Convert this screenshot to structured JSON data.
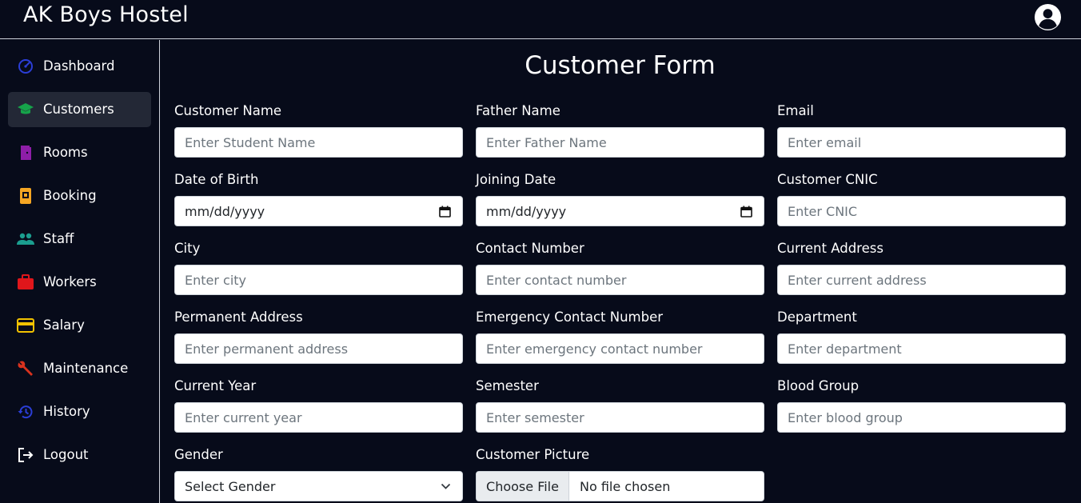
{
  "app": {
    "title": "AK Boys Hostel"
  },
  "sidebar": {
    "items": [
      {
        "label": "Dashboard",
        "icon": "dashboard-gauge-icon",
        "color": "#2b3ed6"
      },
      {
        "label": "Customers",
        "icon": "graduation-cap-icon",
        "color": "#16a34a",
        "active": true
      },
      {
        "label": "Rooms",
        "icon": "door-icon",
        "color": "#8e1ea8"
      },
      {
        "label": "Booking",
        "icon": "booking-icon",
        "color": "#f5a623"
      },
      {
        "label": "Staff",
        "icon": "people-icon",
        "color": "#1b9e8f"
      },
      {
        "label": "Workers",
        "icon": "briefcase-icon",
        "color": "#e0161b"
      },
      {
        "label": "Salary",
        "icon": "credit-card-icon",
        "color": "#f2c200"
      },
      {
        "label": "Maintenance",
        "icon": "wrench-icon",
        "color": "#d9321e"
      },
      {
        "label": "History",
        "icon": "history-icon",
        "color": "#2b3ed6"
      },
      {
        "label": "Logout",
        "icon": "logout-icon",
        "color": "#ffffff"
      }
    ]
  },
  "form": {
    "title": "Customer Form",
    "fields": {
      "customer_name": {
        "label": "Customer Name",
        "placeholder": "Enter Student Name"
      },
      "father_name": {
        "label": "Father Name",
        "placeholder": "Enter Father Name"
      },
      "email": {
        "label": "Email",
        "placeholder": "Enter email"
      },
      "date_of_birth": {
        "label": "Date of Birth",
        "value": "mm/dd/yyyy"
      },
      "joining_date": {
        "label": "Joining Date",
        "value": "mm/dd/yyyy"
      },
      "cnic": {
        "label": "Customer CNIC",
        "placeholder": "Enter CNIC"
      },
      "city": {
        "label": "City",
        "placeholder": "Enter city"
      },
      "contact_number": {
        "label": "Contact Number",
        "placeholder": "Enter contact number"
      },
      "current_address": {
        "label": "Current Address",
        "placeholder": "Enter current address"
      },
      "permanent_address": {
        "label": "Permanent Address",
        "placeholder": "Enter permanent address"
      },
      "emergency_contact": {
        "label": "Emergency Contact Number",
        "placeholder": "Enter emergency contact number"
      },
      "department": {
        "label": "Department",
        "placeholder": "Enter department"
      },
      "current_year": {
        "label": "Current Year",
        "placeholder": "Enter current year"
      },
      "semester": {
        "label": "Semester",
        "placeholder": "Enter semester"
      },
      "blood_group": {
        "label": "Blood Group",
        "placeholder": "Enter blood group"
      },
      "gender": {
        "label": "Gender",
        "selected": "Select Gender"
      },
      "picture": {
        "label": "Customer Picture",
        "button": "Choose File",
        "status": "No file chosen"
      }
    }
  },
  "colors": {
    "background": "#070b1a",
    "active_item": "#232836",
    "input_border": "#ced4da"
  }
}
